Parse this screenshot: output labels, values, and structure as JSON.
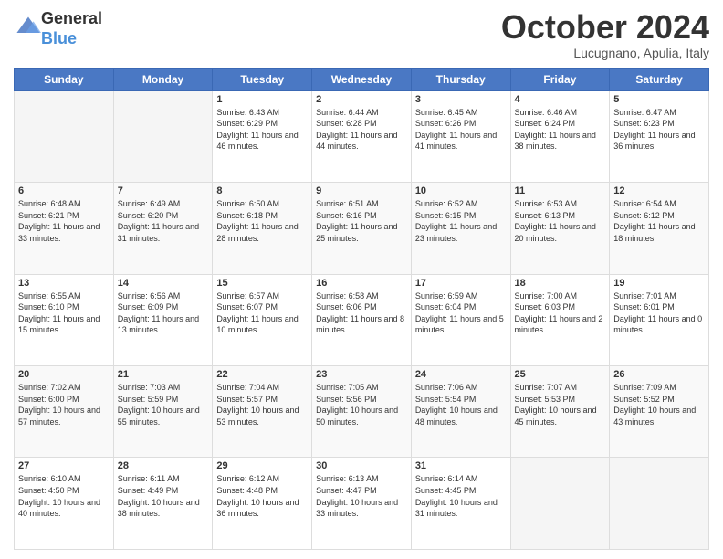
{
  "header": {
    "logo_general": "General",
    "logo_blue": "Blue",
    "month_title": "October 2024",
    "location": "Lucugnano, Apulia, Italy"
  },
  "days_of_week": [
    "Sunday",
    "Monday",
    "Tuesday",
    "Wednesday",
    "Thursday",
    "Friday",
    "Saturday"
  ],
  "weeks": [
    [
      {
        "day": "",
        "sunrise": "",
        "sunset": "",
        "daylight": ""
      },
      {
        "day": "",
        "sunrise": "",
        "sunset": "",
        "daylight": ""
      },
      {
        "day": "1",
        "sunrise": "Sunrise: 6:43 AM",
        "sunset": "Sunset: 6:29 PM",
        "daylight": "Daylight: 11 hours and 46 minutes."
      },
      {
        "day": "2",
        "sunrise": "Sunrise: 6:44 AM",
        "sunset": "Sunset: 6:28 PM",
        "daylight": "Daylight: 11 hours and 44 minutes."
      },
      {
        "day": "3",
        "sunrise": "Sunrise: 6:45 AM",
        "sunset": "Sunset: 6:26 PM",
        "daylight": "Daylight: 11 hours and 41 minutes."
      },
      {
        "day": "4",
        "sunrise": "Sunrise: 6:46 AM",
        "sunset": "Sunset: 6:24 PM",
        "daylight": "Daylight: 11 hours and 38 minutes."
      },
      {
        "day": "5",
        "sunrise": "Sunrise: 6:47 AM",
        "sunset": "Sunset: 6:23 PM",
        "daylight": "Daylight: 11 hours and 36 minutes."
      }
    ],
    [
      {
        "day": "6",
        "sunrise": "Sunrise: 6:48 AM",
        "sunset": "Sunset: 6:21 PM",
        "daylight": "Daylight: 11 hours and 33 minutes."
      },
      {
        "day": "7",
        "sunrise": "Sunrise: 6:49 AM",
        "sunset": "Sunset: 6:20 PM",
        "daylight": "Daylight: 11 hours and 31 minutes."
      },
      {
        "day": "8",
        "sunrise": "Sunrise: 6:50 AM",
        "sunset": "Sunset: 6:18 PM",
        "daylight": "Daylight: 11 hours and 28 minutes."
      },
      {
        "day": "9",
        "sunrise": "Sunrise: 6:51 AM",
        "sunset": "Sunset: 6:16 PM",
        "daylight": "Daylight: 11 hours and 25 minutes."
      },
      {
        "day": "10",
        "sunrise": "Sunrise: 6:52 AM",
        "sunset": "Sunset: 6:15 PM",
        "daylight": "Daylight: 11 hours and 23 minutes."
      },
      {
        "day": "11",
        "sunrise": "Sunrise: 6:53 AM",
        "sunset": "Sunset: 6:13 PM",
        "daylight": "Daylight: 11 hours and 20 minutes."
      },
      {
        "day": "12",
        "sunrise": "Sunrise: 6:54 AM",
        "sunset": "Sunset: 6:12 PM",
        "daylight": "Daylight: 11 hours and 18 minutes."
      }
    ],
    [
      {
        "day": "13",
        "sunrise": "Sunrise: 6:55 AM",
        "sunset": "Sunset: 6:10 PM",
        "daylight": "Daylight: 11 hours and 15 minutes."
      },
      {
        "day": "14",
        "sunrise": "Sunrise: 6:56 AM",
        "sunset": "Sunset: 6:09 PM",
        "daylight": "Daylight: 11 hours and 13 minutes."
      },
      {
        "day": "15",
        "sunrise": "Sunrise: 6:57 AM",
        "sunset": "Sunset: 6:07 PM",
        "daylight": "Daylight: 11 hours and 10 minutes."
      },
      {
        "day": "16",
        "sunrise": "Sunrise: 6:58 AM",
        "sunset": "Sunset: 6:06 PM",
        "daylight": "Daylight: 11 hours and 8 minutes."
      },
      {
        "day": "17",
        "sunrise": "Sunrise: 6:59 AM",
        "sunset": "Sunset: 6:04 PM",
        "daylight": "Daylight: 11 hours and 5 minutes."
      },
      {
        "day": "18",
        "sunrise": "Sunrise: 7:00 AM",
        "sunset": "Sunset: 6:03 PM",
        "daylight": "Daylight: 11 hours and 2 minutes."
      },
      {
        "day": "19",
        "sunrise": "Sunrise: 7:01 AM",
        "sunset": "Sunset: 6:01 PM",
        "daylight": "Daylight: 11 hours and 0 minutes."
      }
    ],
    [
      {
        "day": "20",
        "sunrise": "Sunrise: 7:02 AM",
        "sunset": "Sunset: 6:00 PM",
        "daylight": "Daylight: 10 hours and 57 minutes."
      },
      {
        "day": "21",
        "sunrise": "Sunrise: 7:03 AM",
        "sunset": "Sunset: 5:59 PM",
        "daylight": "Daylight: 10 hours and 55 minutes."
      },
      {
        "day": "22",
        "sunrise": "Sunrise: 7:04 AM",
        "sunset": "Sunset: 5:57 PM",
        "daylight": "Daylight: 10 hours and 53 minutes."
      },
      {
        "day": "23",
        "sunrise": "Sunrise: 7:05 AM",
        "sunset": "Sunset: 5:56 PM",
        "daylight": "Daylight: 10 hours and 50 minutes."
      },
      {
        "day": "24",
        "sunrise": "Sunrise: 7:06 AM",
        "sunset": "Sunset: 5:54 PM",
        "daylight": "Daylight: 10 hours and 48 minutes."
      },
      {
        "day": "25",
        "sunrise": "Sunrise: 7:07 AM",
        "sunset": "Sunset: 5:53 PM",
        "daylight": "Daylight: 10 hours and 45 minutes."
      },
      {
        "day": "26",
        "sunrise": "Sunrise: 7:09 AM",
        "sunset": "Sunset: 5:52 PM",
        "daylight": "Daylight: 10 hours and 43 minutes."
      }
    ],
    [
      {
        "day": "27",
        "sunrise": "Sunrise: 6:10 AM",
        "sunset": "Sunset: 4:50 PM",
        "daylight": "Daylight: 10 hours and 40 minutes."
      },
      {
        "day": "28",
        "sunrise": "Sunrise: 6:11 AM",
        "sunset": "Sunset: 4:49 PM",
        "daylight": "Daylight: 10 hours and 38 minutes."
      },
      {
        "day": "29",
        "sunrise": "Sunrise: 6:12 AM",
        "sunset": "Sunset: 4:48 PM",
        "daylight": "Daylight: 10 hours and 36 minutes."
      },
      {
        "day": "30",
        "sunrise": "Sunrise: 6:13 AM",
        "sunset": "Sunset: 4:47 PM",
        "daylight": "Daylight: 10 hours and 33 minutes."
      },
      {
        "day": "31",
        "sunrise": "Sunrise: 6:14 AM",
        "sunset": "Sunset: 4:45 PM",
        "daylight": "Daylight: 10 hours and 31 minutes."
      },
      {
        "day": "",
        "sunrise": "",
        "sunset": "",
        "daylight": ""
      },
      {
        "day": "",
        "sunrise": "",
        "sunset": "",
        "daylight": ""
      }
    ]
  ]
}
